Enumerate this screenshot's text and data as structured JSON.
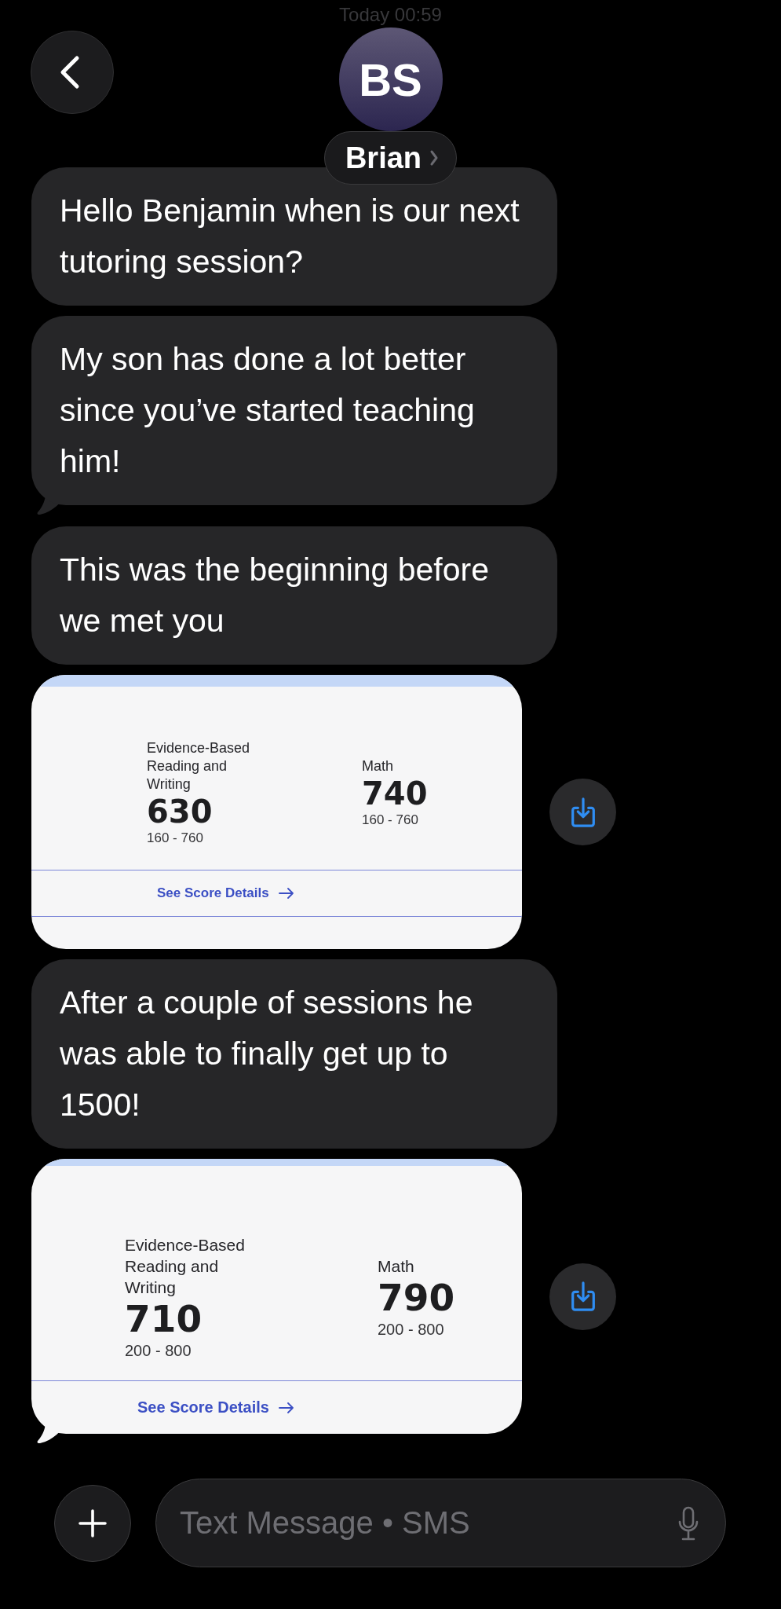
{
  "header": {
    "timestamp": "Today 00:59",
    "avatar_initials": "BS",
    "contact_name": "Brian"
  },
  "messages": [
    {
      "kind": "text",
      "text": "Hello Benjamin when is our next tutoring session?",
      "tail": false
    },
    {
      "kind": "text",
      "text": "My son has done a lot better since you’ve started teaching him!",
      "tail": true
    },
    {
      "kind": "text",
      "text": "This was the beginning before we met you",
      "tail": false
    },
    {
      "kind": "image",
      "card": {
        "columns": [
          {
            "label": "Evidence-Based Reading and Writing",
            "score": "630",
            "range": "160 - 760"
          },
          {
            "label": "Math",
            "score": "740",
            "range": "160 - 760"
          }
        ],
        "link": "See Score Details"
      },
      "tail": false
    },
    {
      "kind": "text",
      "text": "After a couple of sessions he was able to finally get up to 1500!",
      "tail": false
    },
    {
      "kind": "image",
      "card": {
        "columns": [
          {
            "label": "Evidence-Based Reading and Writing",
            "score": "710",
            "range": "200 - 800"
          },
          {
            "label": "Math",
            "score": "790",
            "range": "200 - 800"
          }
        ],
        "link": "See Score Details"
      },
      "tail": true
    }
  ],
  "composer": {
    "placeholder": "Text Message • SMS"
  }
}
